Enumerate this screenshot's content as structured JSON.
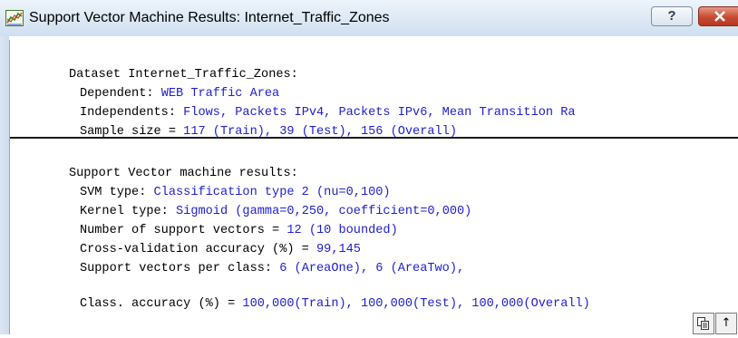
{
  "window": {
    "title": "Support Vector Machine Results: Internet_Traffic_Zones",
    "help_label": "?",
    "close_icon": "close-icon",
    "app_icon": "chart-window-icon"
  },
  "dataset": {
    "header": "Dataset Internet_Traffic_Zones:",
    "dependent_label": "Dependent: ",
    "dependent_value": "WEB Traffic Area",
    "independents_label": "Independents: ",
    "independents_value": "Flows, Packets IPv4, Packets IPv6, Mean Transition Ra",
    "sample_label": "Sample size = ",
    "sample_value": "117 (Train), 39 (Test), 156 (Overall)"
  },
  "results": {
    "header": "Support Vector machine results:",
    "svm_type_label": "SVM type: ",
    "svm_type_value": "Classification type 2 (nu=0,100)",
    "kernel_label": "Kernel type: ",
    "kernel_value": "Sigmoid (gamma=0,250, coefficient=0,000)",
    "support_vectors_label": "Number of support vectors = ",
    "support_vectors_value": "12 (10 bounded)",
    "cv_label": "Cross-validation accuracy (%) = ",
    "cv_value": "99,145",
    "per_class_label": "Support vectors per class: ",
    "per_class_value": "6 (AreaOne), 6 (AreaTwo),",
    "class_accuracy_label": "Class. accuracy (%) = ",
    "class_accuracy_value": "100,000(Train), 100,000(Test), 100,000(Overall)"
  },
  "corner_buttons": {
    "copy_icon": "copy-icon",
    "scroll_top_glyph": "↑"
  },
  "colors": {
    "value_text": "#2020d0",
    "title_bar": "#dce8f5",
    "close_button": "#c74a31"
  }
}
